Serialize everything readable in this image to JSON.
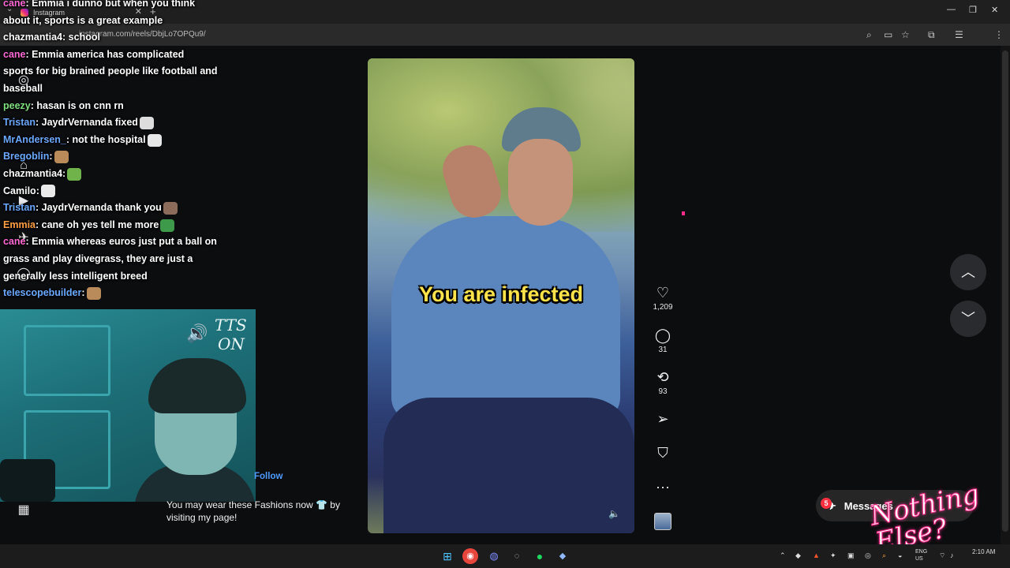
{
  "browser": {
    "tab_title": "Instagram",
    "url": "instagram.com/reels/DbjLo7OPQu9/",
    "new_tab_glyph": "+",
    "tab_close_glyph": "✕",
    "menu_glyph": "⌄",
    "window_controls": [
      "—",
      "❐",
      "✕"
    ]
  },
  "chat": {
    "messages": [
      {
        "user": "cane",
        "user_color": "#ff6ad5",
        "text": ": Emmia i dunno but when you think"
      },
      {
        "user": "",
        "user_color": "#ffffff",
        "text": "about it, sports is a great example"
      },
      {
        "user": "chazmantia4",
        "user_color": "#ffffff",
        "text": ": school"
      },
      {
        "user": "cane",
        "user_color": "#ff6ad5",
        "text": ": Emmia america has complicated"
      },
      {
        "user": "",
        "user_color": "#ffffff",
        "text": "sports for big brained people like football and"
      },
      {
        "user": "",
        "user_color": "#ffffff",
        "text": "baseball"
      },
      {
        "user": "peezy",
        "user_color": "#7ee07e",
        "text": ": hasan is on cnn rn"
      },
      {
        "user": "Tristan",
        "user_color": "#6aa9ff",
        "text": ": JaydrVernanda fixed"
      },
      {
        "user": "MrAndersen_",
        "user_color": "#6aa9ff",
        "text": ":  not the hospital"
      },
      {
        "user": "Bregoblin",
        "user_color": "#6aa9ff",
        "text": ":"
      },
      {
        "user": "chazmantia4",
        "user_color": "#ffffff",
        "text": ":"
      },
      {
        "user": "Camilo",
        "user_color": "#ffffff",
        "text": ":"
      },
      {
        "user": "Tristan",
        "user_color": "#6aa9ff",
        "text": ": JaydrVernanda thank you"
      },
      {
        "user": "Emmia",
        "user_color": "#ff9f43",
        "text": ": cane  oh yes tell me more"
      },
      {
        "user": "cane",
        "user_color": "#ff6ad5",
        "text": ": Emmia whereas euros just put a ball on"
      },
      {
        "user": "",
        "user_color": "#ffffff",
        "text": "grass and play divegrass, they are just a"
      },
      {
        "user": "",
        "user_color": "#ffffff",
        "text": "generally less intelligent breed"
      },
      {
        "user": "telescopebuilder",
        "user_color": "#6aa9ff",
        "text": ":"
      }
    ]
  },
  "overlay": {
    "tts_line1": "TTS",
    "tts_line2": "ON",
    "speaker_glyph": "🔊",
    "follow_label": "Follow",
    "fashion_text": "You may wear these Fashions now 👕 by visiting my page!",
    "watermark": "Nothing Else?"
  },
  "reel": {
    "caption": "You are infected",
    "mute_glyph": "🔈"
  },
  "actions": {
    "like_glyph": "♡",
    "like_count": "1,209",
    "comment_glyph": "◯",
    "comment_count": "31",
    "repost_glyph": "⟲",
    "repost_count": "93",
    "share_glyph": "➢",
    "save_glyph": "⛉",
    "more_glyph": "···"
  },
  "nav": {
    "up_glyph": "︿",
    "down_glyph": "﹀"
  },
  "messages": {
    "label": "Messages",
    "badge": "5",
    "icon_glyph": "✈"
  },
  "sidenav_icons": [
    "◎",
    "⌂",
    "▶",
    "✈",
    "◯",
    "▦"
  ],
  "taskbar": {
    "time": "2:10 AM",
    "lang_line1": "ENG",
    "lang_line2": "US"
  },
  "colors": {
    "accent_pink": "#ff2c8c",
    "caption_yellow": "#ffe34a",
    "link_blue": "#4f9cff",
    "badge_red": "#ff3040"
  }
}
